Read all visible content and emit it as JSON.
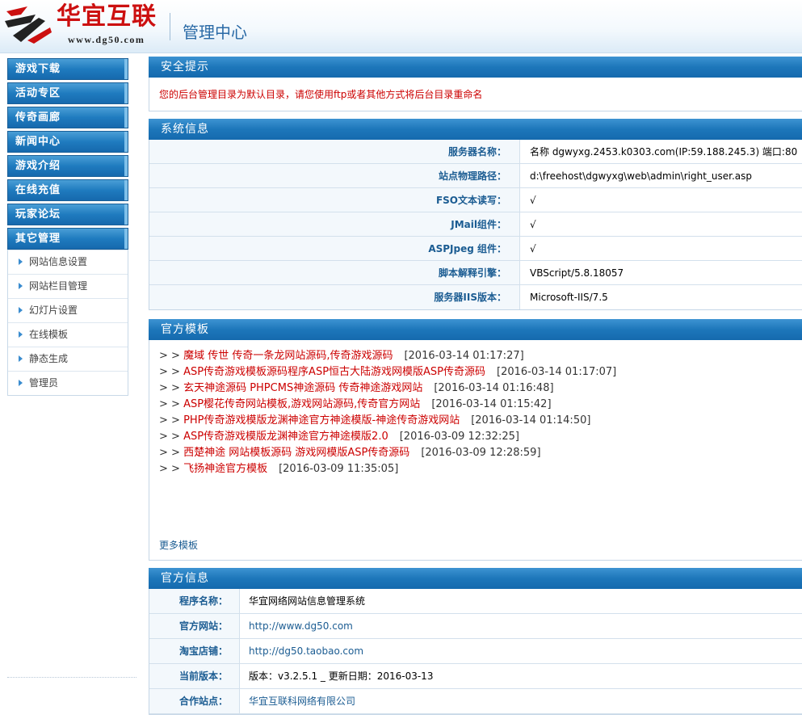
{
  "header": {
    "logo_text": "华宜互联",
    "logo_url": "www.dg50.com",
    "title": "管理中心"
  },
  "colors": {
    "nav_blue": "#1f7bbf",
    "alert_red": "#cc0000",
    "label_blue": "#1b5c92"
  },
  "sidebar": {
    "items": [
      {
        "label": "游戏下载"
      },
      {
        "label": "活动专区"
      },
      {
        "label": "传奇画廊"
      },
      {
        "label": "新闻中心"
      },
      {
        "label": "游戏介绍"
      },
      {
        "label": "在线充值"
      },
      {
        "label": "玩家论坛"
      },
      {
        "label": "其它管理"
      }
    ],
    "subitems": [
      {
        "label": "网站信息设置"
      },
      {
        "label": "网站栏目管理"
      },
      {
        "label": "幻灯片设置"
      },
      {
        "label": "在线模板"
      },
      {
        "label": "静态生成"
      },
      {
        "label": "管理员"
      }
    ]
  },
  "security": {
    "title": "安全提示",
    "message": "您的后台管理目录为默认目录，请您使用ftp或者其他方式将后台目录重命名"
  },
  "system": {
    "title": "系统信息",
    "rows": [
      {
        "label": "服务器名称：",
        "value": "名称 dgwyxg.2453.k0303.com(IP:59.188.245.3) 端口:80"
      },
      {
        "label": "站点物理路径：",
        "value": "d:\\freehost\\dgwyxg\\web\\admin\\right_user.asp"
      },
      {
        "label": "FSO文本读写：",
        "value": "√"
      },
      {
        "label": "JMail组件：",
        "value": "√"
      },
      {
        "label": "ASPJpeg 组件：",
        "value": "√"
      },
      {
        "label": "脚本解释引擎：",
        "value": "VBScript/5.8.18057"
      },
      {
        "label": "服务器IIS版本：",
        "value": "Microsoft-IIS/7.5"
      }
    ]
  },
  "templates": {
    "title": "官方模板",
    "prefix": "> >",
    "items": [
      {
        "title": "魔域 传世 传奇一条龙网站源码,传奇游戏源码",
        "date": "[2016-03-14 01:17:27]"
      },
      {
        "title": "ASP传奇游戏模板源码程序ASP恒古大陆游戏网模版ASP传奇源码",
        "date": "[2016-03-14 01:17:07]"
      },
      {
        "title": "玄天神途源码 PHPCMS神途源码 传奇神途游戏网站",
        "date": "[2016-03-14 01:16:48]"
      },
      {
        "title": "ASP樱花传奇网站模板,游戏网站源码,传奇官方网站",
        "date": "[2016-03-14 01:15:42]"
      },
      {
        "title": "PHP传奇游戏模版龙渊神途官方神途模版-神途传奇游戏网站",
        "date": "[2016-03-14 01:14:50]"
      },
      {
        "title": "ASP传奇游戏模版龙渊神途官方神途模版2.0",
        "date": "[2016-03-09 12:32:25]"
      },
      {
        "title": "西楚神途 网站模板源码 游戏网模版ASP传奇源码",
        "date": "[2016-03-09 12:28:59]"
      },
      {
        "title": "飞扬神途官方模板",
        "date": "[2016-03-09 11:35:05]"
      }
    ],
    "more": "更多模板"
  },
  "official": {
    "title": "官方信息",
    "rows": [
      {
        "label": "程序名称：",
        "value": "华宜网络网站信息管理系统"
      },
      {
        "label": "官方网站：",
        "value": "http://www.dg50.com"
      },
      {
        "label": "淘宝店铺：",
        "value": "http://dg50.taobao.com"
      },
      {
        "label": "当前版本：",
        "value": "版本：v3.2.5.1 _ 更新日期：2016-03-13"
      },
      {
        "label": "合作站点：",
        "value": "华宜互联科网络有限公司"
      }
    ]
  }
}
